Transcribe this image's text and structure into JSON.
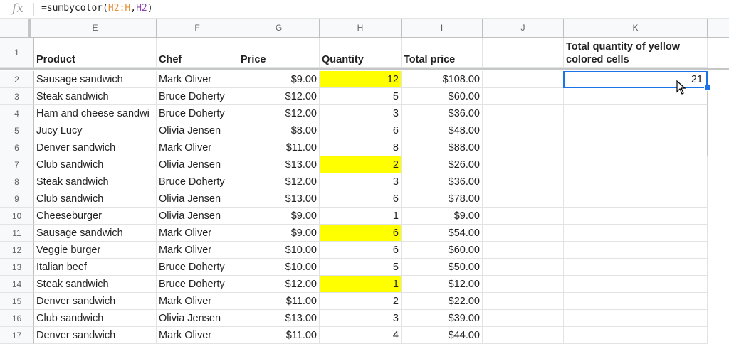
{
  "formula_bar": {
    "fx_label": "fx",
    "prefix": "=sumbycolor(",
    "ref1": "H2:H",
    "comma": ",",
    "ref2": "H2",
    "suffix": ")"
  },
  "columns": [
    "E",
    "F",
    "G",
    "H",
    "I",
    "J",
    "K"
  ],
  "row_numbers": [
    "1",
    "2",
    "3",
    "4",
    "5",
    "6",
    "7",
    "8",
    "9",
    "10",
    "11",
    "12",
    "13",
    "14",
    "15",
    "16",
    "17"
  ],
  "headers": {
    "product": "Product",
    "chef": "Chef",
    "price": "Price",
    "quantity": "Quantity",
    "total_price": "Total price",
    "k_label": "Total quantity of yellow colored cells"
  },
  "rows": [
    {
      "product": "Sausage sandwich",
      "chef": "Mark Oliver",
      "price": "$9.00",
      "quantity": "12",
      "total": "$108.00",
      "yellow": true
    },
    {
      "product": "Steak sandwich",
      "chef": "Bruce Doherty",
      "price": "$12.00",
      "quantity": "5",
      "total": "$60.00",
      "yellow": false
    },
    {
      "product": "Ham and cheese sandwi",
      "chef": "Bruce Doherty",
      "price": "$12.00",
      "quantity": "3",
      "total": "$36.00",
      "yellow": false
    },
    {
      "product": "Jucy Lucy",
      "chef": "Olivia Jensen",
      "price": "$8.00",
      "quantity": "6",
      "total": "$48.00",
      "yellow": false
    },
    {
      "product": "Denver sandwich",
      "chef": "Mark Oliver",
      "price": "$11.00",
      "quantity": "8",
      "total": "$88.00",
      "yellow": false
    },
    {
      "product": "Club sandwich",
      "chef": "Olivia Jensen",
      "price": "$13.00",
      "quantity": "2",
      "total": "$26.00",
      "yellow": true
    },
    {
      "product": "Steak sandwich",
      "chef": "Bruce Doherty",
      "price": "$12.00",
      "quantity": "3",
      "total": "$36.00",
      "yellow": false
    },
    {
      "product": "Club sandwich",
      "chef": "Olivia Jensen",
      "price": "$13.00",
      "quantity": "6",
      "total": "$78.00",
      "yellow": false
    },
    {
      "product": "Cheeseburger",
      "chef": "Olivia Jensen",
      "price": "$9.00",
      "quantity": "1",
      "total": "$9.00",
      "yellow": false
    },
    {
      "product": "Sausage sandwich",
      "chef": "Mark Oliver",
      "price": "$9.00",
      "quantity": "6",
      "total": "$54.00",
      "yellow": true
    },
    {
      "product": "Veggie burger",
      "chef": "Mark Oliver",
      "price": "$10.00",
      "quantity": "6",
      "total": "$60.00",
      "yellow": false
    },
    {
      "product": "Italian beef",
      "chef": "Bruce Doherty",
      "price": "$10.00",
      "quantity": "5",
      "total": "$50.00",
      "yellow": false
    },
    {
      "product": "Steak sandwich",
      "chef": "Bruce Doherty",
      "price": "$12.00",
      "quantity": "1",
      "total": "$12.00",
      "yellow": true
    },
    {
      "product": "Denver sandwich",
      "chef": "Mark Oliver",
      "price": "$11.00",
      "quantity": "2",
      "total": "$22.00",
      "yellow": false
    },
    {
      "product": "Club sandwich",
      "chef": "Olivia Jensen",
      "price": "$13.00",
      "quantity": "3",
      "total": "$39.00",
      "yellow": false
    },
    {
      "product": "Denver sandwich",
      "chef": "Mark Oliver",
      "price": "$11.00",
      "quantity": "4",
      "total": "$44.00",
      "yellow": false
    }
  ],
  "k2_value": "21",
  "colors": {
    "highlight": "#ffff00",
    "selection": "#1a73e8"
  }
}
